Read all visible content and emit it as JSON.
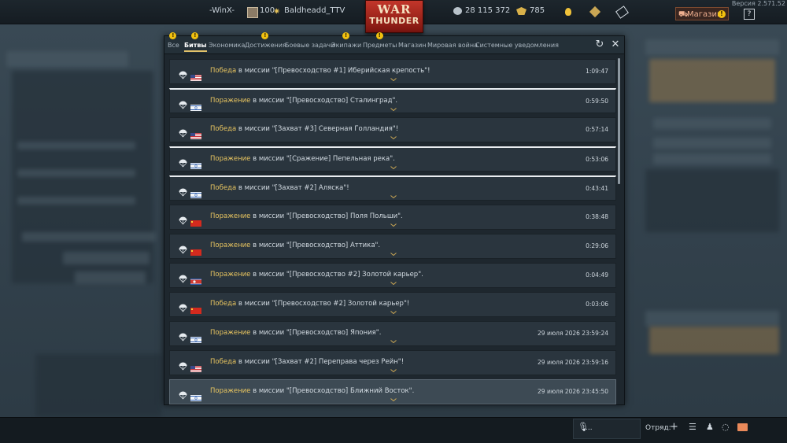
{
  "header": {
    "version": "Версия 2.571.52",
    "squad_tag": "-WinX-",
    "player_level": "100",
    "player_name": "Baldheadd_TTV",
    "silver_lions": "28 115 372",
    "golden_eagles": "785",
    "shop_label": "Магазин",
    "help_label": "?",
    "logo_top": "WAR",
    "logo_bottom": "THUNDER"
  },
  "tabs": [
    {
      "label": "Все",
      "warn": true
    },
    {
      "label": "Битвы",
      "warn": true,
      "active": true
    },
    {
      "label": "Экономика",
      "warn": false
    },
    {
      "label": "Достижения",
      "warn": true
    },
    {
      "label": "Боевые задачи",
      "warn": false
    },
    {
      "label": "Экипажи",
      "warn": true
    },
    {
      "label": "Предметы",
      "warn": true
    },
    {
      "label": "Магазин",
      "warn": false
    },
    {
      "label": "Мировая война",
      "warn": false
    },
    {
      "label": "Системные уведомления",
      "warn": false
    }
  ],
  "warn_glyph": "!",
  "battles": [
    {
      "result": "Победа",
      "text": " в миссии \"[Превосходство #1] Иберийская крепость\"!",
      "time": "1:09:47",
      "flag": "usa",
      "unread": false
    },
    {
      "result": "Поражение",
      "text": " в миссии \"[Превосходство] Сталинград\".",
      "time": "0:59:50",
      "flag": "israel",
      "unread": true
    },
    {
      "result": "Победа",
      "text": " в миссии \"[Захват #3] Северная Голландия\"!",
      "time": "0:57:14",
      "flag": "usa",
      "unread": false
    },
    {
      "result": "Поражение",
      "text": " в миссии \"[Сражение] Пепельная река\".",
      "time": "0:53:06",
      "flag": "israel",
      "unread": true
    },
    {
      "result": "Победа",
      "text": " в миссии \"[Захват #2] Аляска\"!",
      "time": "0:43:41",
      "flag": "israel",
      "unread": true
    },
    {
      "result": "Поражение",
      "text": " в миссии \"[Превосходство] Поля Польши\".",
      "time": "0:38:48",
      "flag": "china",
      "unread": false
    },
    {
      "result": "Поражение",
      "text": " в миссии \"[Превосходство] Аттика\".",
      "time": "0:29:06",
      "flag": "china",
      "unread": false
    },
    {
      "result": "Поражение",
      "text": " в миссии \"[Превосходство #2] Золотой карьер\".",
      "time": "0:04:49",
      "flag": "korea",
      "unread": false
    },
    {
      "result": "Победа",
      "text": " в миссии \"[Превосходство #2] Золотой карьер\"!",
      "time": "0:03:06",
      "flag": "china",
      "unread": false
    },
    {
      "result": "Поражение",
      "text": " в миссии \"[Превосходство] Япония\".",
      "time": "29 июля 2026 23:59:24",
      "flag": "israel",
      "unread": false
    },
    {
      "result": "Победа",
      "text": " в миссии \"[Захват #2] Переправа через Рейн\"!",
      "time": "29 июля 2026 23:59:16",
      "flag": "usa",
      "unread": false
    },
    {
      "result": "Поражение",
      "text": " в миссии \"[Превосходство] Ближний Восток\".",
      "time": "29 июля 2026 23:45:50",
      "flag": "israel",
      "unread": false,
      "selected": true
    }
  ],
  "footer": {
    "voice_label": "...",
    "squad_label": "Отряд:"
  },
  "colors": {
    "result": "#e8c560",
    "accent_red": "#c2362a",
    "warn": "#f2c10f",
    "mail": "#e9895a"
  }
}
